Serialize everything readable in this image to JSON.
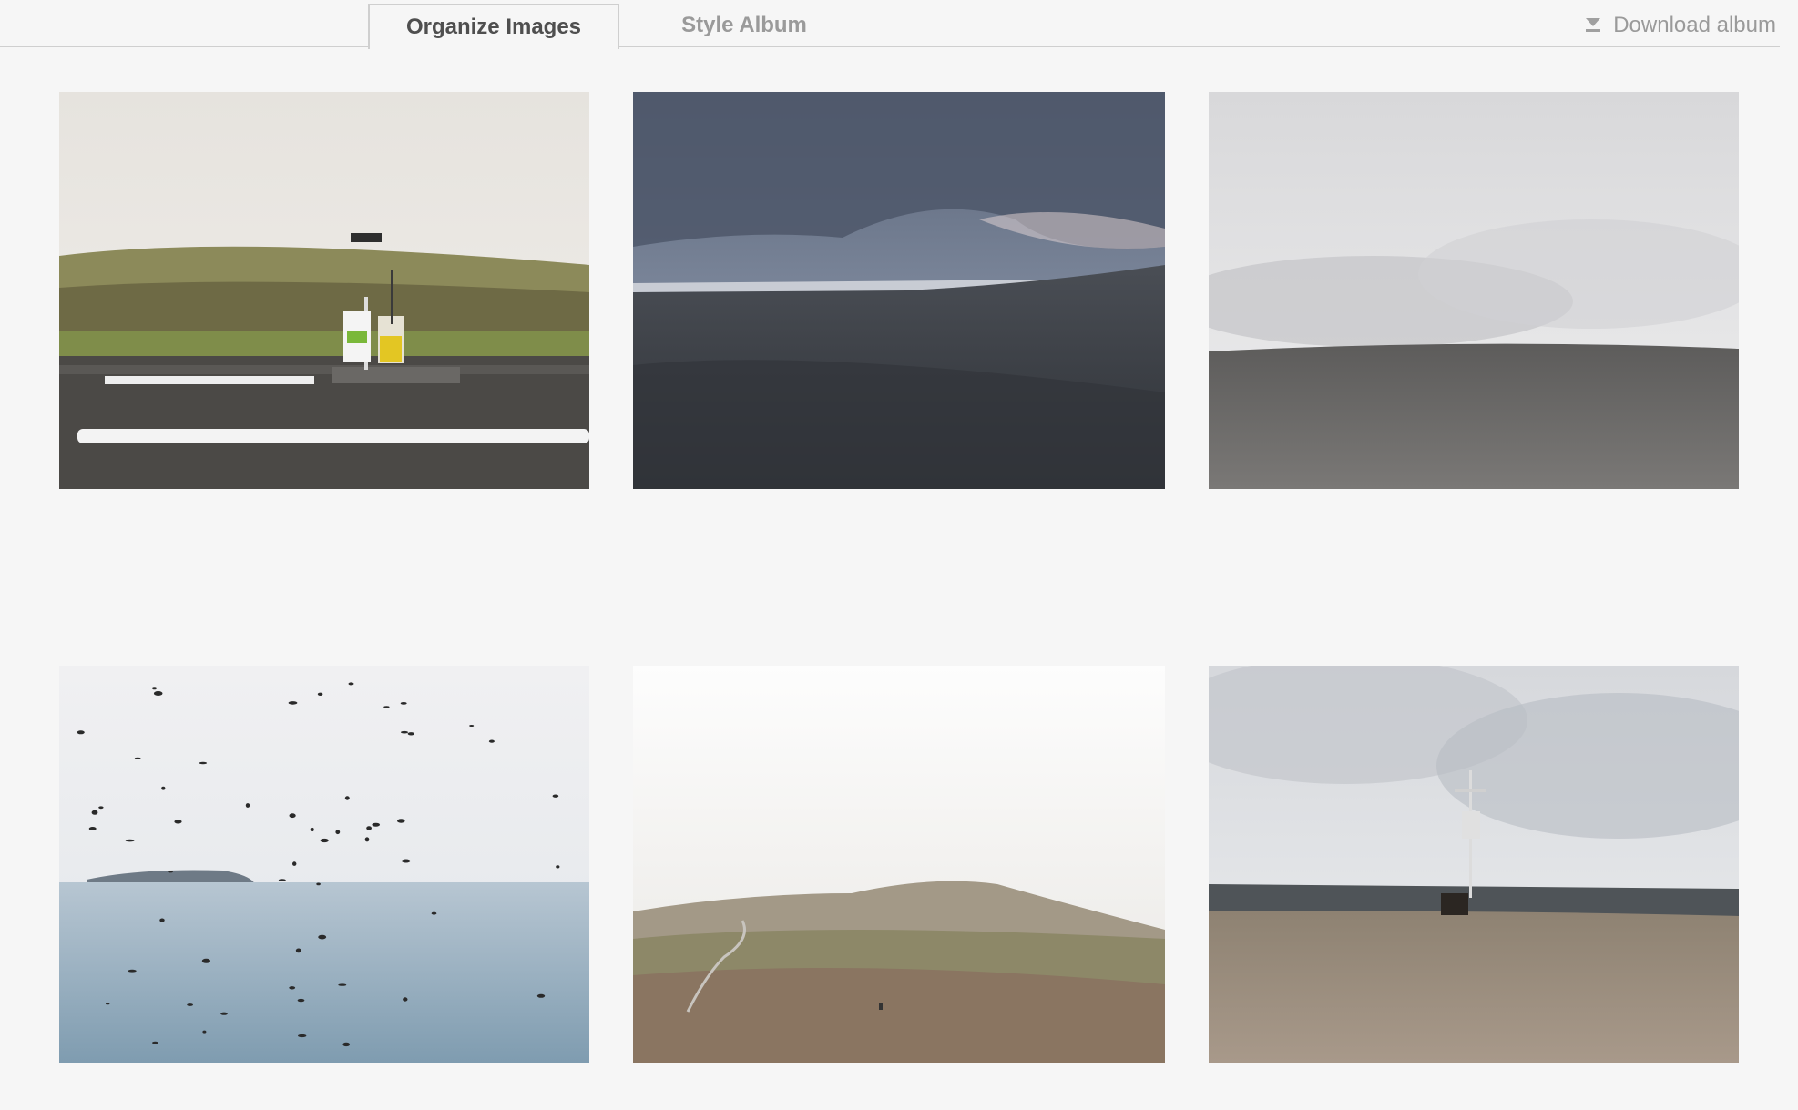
{
  "tabs": [
    {
      "label": "Organize Images",
      "active": true
    },
    {
      "label": "Style Album",
      "active": false
    }
  ],
  "download": {
    "label": "Download album",
    "icon": "download-icon"
  },
  "colors": {
    "background": "#f6f6f6",
    "tab_active_text": "#4f4f4f",
    "tab_inactive_text": "#9a9a9a",
    "divider": "#cfcfcf"
  },
  "photos": [
    {
      "subject": "gas-pump-landscape"
    },
    {
      "subject": "stormy-lava-field"
    },
    {
      "subject": "overcast-gravel-plain"
    },
    {
      "subject": "birds-over-sea"
    },
    {
      "subject": "foggy-hills-road"
    },
    {
      "subject": "radio-mast-plateau"
    }
  ]
}
